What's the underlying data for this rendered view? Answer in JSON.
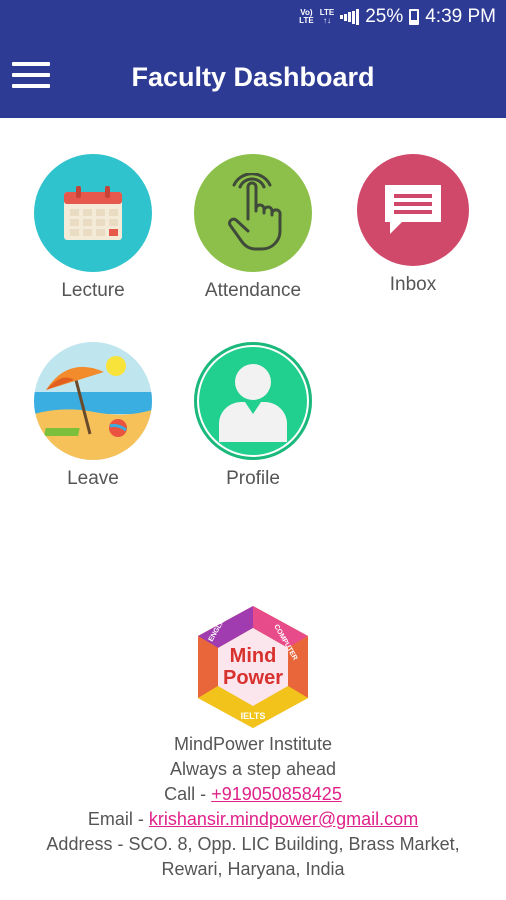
{
  "status_bar": {
    "volte": "Vo LTE",
    "lte": "LTE",
    "battery": "25%",
    "time": "4:39 PM"
  },
  "app_bar": {
    "title": "Faculty Dashboard",
    "menu_icon": "hamburger-menu-icon"
  },
  "dashboard": {
    "tiles": [
      {
        "label": "Lecture",
        "icon": "calendar-icon",
        "color": "#2fc3cd"
      },
      {
        "label": "Attendance",
        "icon": "touch-hand-icon",
        "color": "#8cc04a"
      },
      {
        "label": "Inbox",
        "icon": "message-icon",
        "color": "#d0496a"
      },
      {
        "label": "Leave",
        "icon": "beach-icon",
        "color": "#bfe5ef"
      },
      {
        "label": "Profile",
        "icon": "person-icon",
        "color": "#21d08f"
      }
    ]
  },
  "footer": {
    "logo_text": {
      "top": "Mind",
      "bottom": "Power",
      "left": "ENGLISH",
      "right": "COMPUTER",
      "base": "IELTS"
    },
    "institute": "MindPower Institute",
    "tagline": "Always a step ahead",
    "call_prefix": "Call - ",
    "phone": "+919050858425",
    "email_prefix": "Email - ",
    "email": "krishansir.mindpower@gmail.com",
    "address_line1": "Address - SCO. 8, Opp. LIC Building, Brass Market,",
    "address_line2": "Rewari, Haryana, India"
  }
}
